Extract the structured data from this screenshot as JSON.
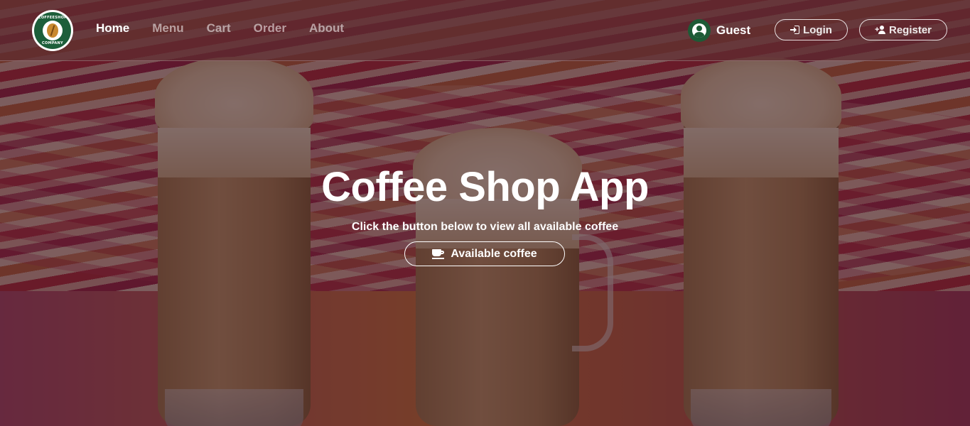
{
  "brand": {
    "logo_top_text": "COFFEESHOP",
    "logo_bottom_text": "COMPANY"
  },
  "nav": {
    "items": [
      {
        "label": "Home",
        "active": true
      },
      {
        "label": "Menu",
        "active": false
      },
      {
        "label": "Cart",
        "active": false
      },
      {
        "label": "Order",
        "active": false
      },
      {
        "label": "About",
        "active": false
      }
    ]
  },
  "user": {
    "name": "Guest",
    "icon": "user-circle-icon"
  },
  "auth": {
    "login_label": "Login",
    "login_icon": "login-icon",
    "register_label": "Register",
    "register_icon": "user-plus-icon"
  },
  "hero": {
    "title": "Coffee Shop App",
    "subtitle": "Click the button below to view all available coffee",
    "button_label": "Available coffee",
    "button_icon": "coffee-cup-icon"
  },
  "colors": {
    "brand_green": "#1d5a36",
    "navbar_bg": "rgba(95,45,48,0.72)",
    "text": "#ffffff"
  }
}
